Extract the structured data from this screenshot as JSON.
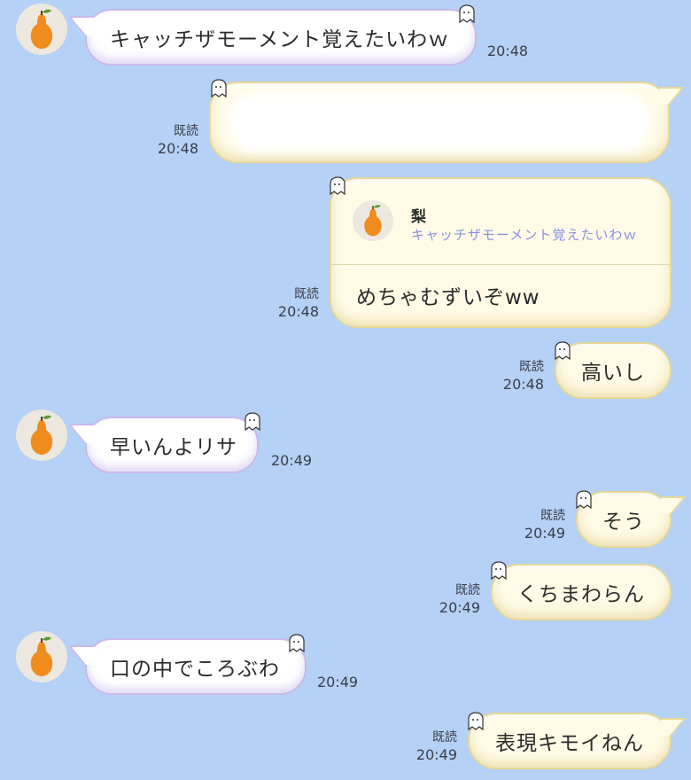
{
  "contact": {
    "name": "梨"
  },
  "labels": {
    "read": "既読"
  },
  "messages": [
    {
      "side": "in",
      "text": "キャッチザモーメント覚えたいわｗ",
      "time": "20:48"
    },
    {
      "side": "out",
      "text": "",
      "read": "既読",
      "time": "20:48",
      "redacted": true
    },
    {
      "side": "out",
      "reply_to_name": "梨",
      "reply_to_text": "キャッチザモーメント覚えたいわｗ",
      "text": "めちゃむずいぞww",
      "read": "既読",
      "time": "20:48"
    },
    {
      "side": "out",
      "text": "高いし",
      "read": "既読",
      "time": "20:48"
    },
    {
      "side": "in",
      "text": "早いんよリサ",
      "time": "20:49"
    },
    {
      "side": "out",
      "text": "そう",
      "read": "既読",
      "time": "20:49"
    },
    {
      "side": "out",
      "text": "くちまわらん",
      "read": "既読",
      "time": "20:49"
    },
    {
      "side": "in",
      "text": "口の中でころぶわ",
      "time": "20:49"
    },
    {
      "side": "out",
      "text": "表現キモイねん",
      "read": "既読",
      "time": "20:49"
    }
  ],
  "colors": {
    "background": "#b5d1f5",
    "incoming_bubble": "#ffffff",
    "outgoing_bubble": "#fffbe6",
    "reply_quote": "#8a8fe8",
    "pear": "#f08c1e"
  },
  "icons": {
    "avatar": "pear-icon",
    "bubble_decoration": "ghost-sticker-icon"
  }
}
